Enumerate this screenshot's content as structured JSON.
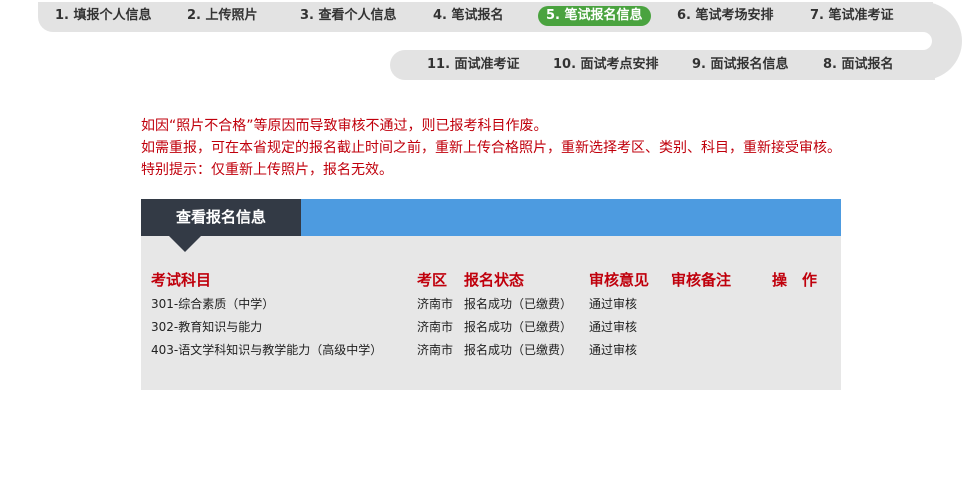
{
  "steps_top": [
    "1. 填报个人信息",
    "2. 上传照片",
    "3. 查看个人信息",
    "4. 笔试报名",
    "5. 笔试报名信息",
    "6. 笔试考场安排",
    "7. 笔试准考证"
  ],
  "steps_bottom": [
    "11. 面试准考证",
    "10. 面试考点安排",
    "9. 面试报名信息",
    "8. 面试报名"
  ],
  "active_step": "5. 笔试报名信息",
  "notice": {
    "line1": "如因“照片不合格”等原因而导致审核不通过，则已报考科目作废。",
    "line2": "如需重报，可在本省规定的报名截止时间之前，重新上传合格照片，重新选择考区、类别、科目，重新接受审核。",
    "line3": "特别提示：仅重新上传照片，报名无效。"
  },
  "panel": {
    "title": "查看报名信息",
    "headers": {
      "subject": "考试科目",
      "area": "考区",
      "status": "报名状态",
      "review": "审核意见",
      "remark": "审核备注",
      "action": "操　作"
    },
    "rows": [
      {
        "subject": "301-综合素质（中学）",
        "area": "济南市",
        "status": "报名成功（已缴费）",
        "review": "通过审核",
        "remark": "",
        "action": ""
      },
      {
        "subject": "302-教育知识与能力",
        "area": "济南市",
        "status": "报名成功（已缴费）",
        "review": "通过审核",
        "remark": "",
        "action": ""
      },
      {
        "subject": "403-语文学科知识与教学能力（高级中学）",
        "area": "济南市",
        "status": "报名成功（已缴费）",
        "review": "通过审核",
        "remark": "",
        "action": ""
      }
    ]
  },
  "colors": {
    "active_step": "#4aa33f",
    "notice_text": "#c0000c",
    "panel_blue": "#4d9be0",
    "panel_dark": "#333a45",
    "panel_bg": "#e7e7e7"
  }
}
